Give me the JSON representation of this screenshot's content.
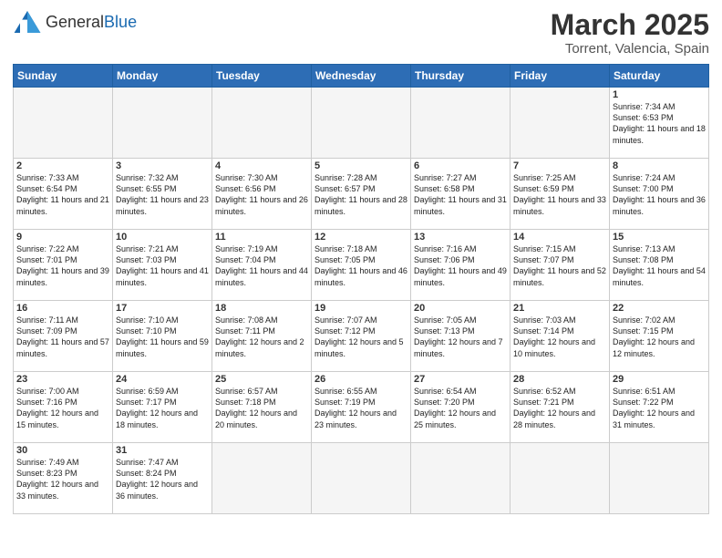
{
  "logo": {
    "text_general": "General",
    "text_blue": "Blue"
  },
  "title": "March 2025",
  "subtitle": "Torrent, Valencia, Spain",
  "days_of_week": [
    "Sunday",
    "Monday",
    "Tuesday",
    "Wednesday",
    "Thursday",
    "Friday",
    "Saturday"
  ],
  "weeks": [
    [
      {
        "day": "",
        "info": ""
      },
      {
        "day": "",
        "info": ""
      },
      {
        "day": "",
        "info": ""
      },
      {
        "day": "",
        "info": ""
      },
      {
        "day": "",
        "info": ""
      },
      {
        "day": "",
        "info": ""
      },
      {
        "day": "1",
        "info": "Sunrise: 7:34 AM\nSunset: 6:53 PM\nDaylight: 11 hours and 18 minutes."
      }
    ],
    [
      {
        "day": "2",
        "info": "Sunrise: 7:33 AM\nSunset: 6:54 PM\nDaylight: 11 hours and 21 minutes."
      },
      {
        "day": "3",
        "info": "Sunrise: 7:32 AM\nSunset: 6:55 PM\nDaylight: 11 hours and 23 minutes."
      },
      {
        "day": "4",
        "info": "Sunrise: 7:30 AM\nSunset: 6:56 PM\nDaylight: 11 hours and 26 minutes."
      },
      {
        "day": "5",
        "info": "Sunrise: 7:28 AM\nSunset: 6:57 PM\nDaylight: 11 hours and 28 minutes."
      },
      {
        "day": "6",
        "info": "Sunrise: 7:27 AM\nSunset: 6:58 PM\nDaylight: 11 hours and 31 minutes."
      },
      {
        "day": "7",
        "info": "Sunrise: 7:25 AM\nSunset: 6:59 PM\nDaylight: 11 hours and 33 minutes."
      },
      {
        "day": "8",
        "info": "Sunrise: 7:24 AM\nSunset: 7:00 PM\nDaylight: 11 hours and 36 minutes."
      }
    ],
    [
      {
        "day": "9",
        "info": "Sunrise: 7:22 AM\nSunset: 7:01 PM\nDaylight: 11 hours and 39 minutes."
      },
      {
        "day": "10",
        "info": "Sunrise: 7:21 AM\nSunset: 7:03 PM\nDaylight: 11 hours and 41 minutes."
      },
      {
        "day": "11",
        "info": "Sunrise: 7:19 AM\nSunset: 7:04 PM\nDaylight: 11 hours and 44 minutes."
      },
      {
        "day": "12",
        "info": "Sunrise: 7:18 AM\nSunset: 7:05 PM\nDaylight: 11 hours and 46 minutes."
      },
      {
        "day": "13",
        "info": "Sunrise: 7:16 AM\nSunset: 7:06 PM\nDaylight: 11 hours and 49 minutes."
      },
      {
        "day": "14",
        "info": "Sunrise: 7:15 AM\nSunset: 7:07 PM\nDaylight: 11 hours and 52 minutes."
      },
      {
        "day": "15",
        "info": "Sunrise: 7:13 AM\nSunset: 7:08 PM\nDaylight: 11 hours and 54 minutes."
      }
    ],
    [
      {
        "day": "16",
        "info": "Sunrise: 7:11 AM\nSunset: 7:09 PM\nDaylight: 11 hours and 57 minutes."
      },
      {
        "day": "17",
        "info": "Sunrise: 7:10 AM\nSunset: 7:10 PM\nDaylight: 11 hours and 59 minutes."
      },
      {
        "day": "18",
        "info": "Sunrise: 7:08 AM\nSunset: 7:11 PM\nDaylight: 12 hours and 2 minutes."
      },
      {
        "day": "19",
        "info": "Sunrise: 7:07 AM\nSunset: 7:12 PM\nDaylight: 12 hours and 5 minutes."
      },
      {
        "day": "20",
        "info": "Sunrise: 7:05 AM\nSunset: 7:13 PM\nDaylight: 12 hours and 7 minutes."
      },
      {
        "day": "21",
        "info": "Sunrise: 7:03 AM\nSunset: 7:14 PM\nDaylight: 12 hours and 10 minutes."
      },
      {
        "day": "22",
        "info": "Sunrise: 7:02 AM\nSunset: 7:15 PM\nDaylight: 12 hours and 12 minutes."
      }
    ],
    [
      {
        "day": "23",
        "info": "Sunrise: 7:00 AM\nSunset: 7:16 PM\nDaylight: 12 hours and 15 minutes."
      },
      {
        "day": "24",
        "info": "Sunrise: 6:59 AM\nSunset: 7:17 PM\nDaylight: 12 hours and 18 minutes."
      },
      {
        "day": "25",
        "info": "Sunrise: 6:57 AM\nSunset: 7:18 PM\nDaylight: 12 hours and 20 minutes."
      },
      {
        "day": "26",
        "info": "Sunrise: 6:55 AM\nSunset: 7:19 PM\nDaylight: 12 hours and 23 minutes."
      },
      {
        "day": "27",
        "info": "Sunrise: 6:54 AM\nSunset: 7:20 PM\nDaylight: 12 hours and 25 minutes."
      },
      {
        "day": "28",
        "info": "Sunrise: 6:52 AM\nSunset: 7:21 PM\nDaylight: 12 hours and 28 minutes."
      },
      {
        "day": "29",
        "info": "Sunrise: 6:51 AM\nSunset: 7:22 PM\nDaylight: 12 hours and 31 minutes."
      }
    ],
    [
      {
        "day": "30",
        "info": "Sunrise: 7:49 AM\nSunset: 8:23 PM\nDaylight: 12 hours and 33 minutes."
      },
      {
        "day": "31",
        "info": "Sunrise: 7:47 AM\nSunset: 8:24 PM\nDaylight: 12 hours and 36 minutes."
      },
      {
        "day": "",
        "info": ""
      },
      {
        "day": "",
        "info": ""
      },
      {
        "day": "",
        "info": ""
      },
      {
        "day": "",
        "info": ""
      },
      {
        "day": "",
        "info": ""
      }
    ]
  ]
}
